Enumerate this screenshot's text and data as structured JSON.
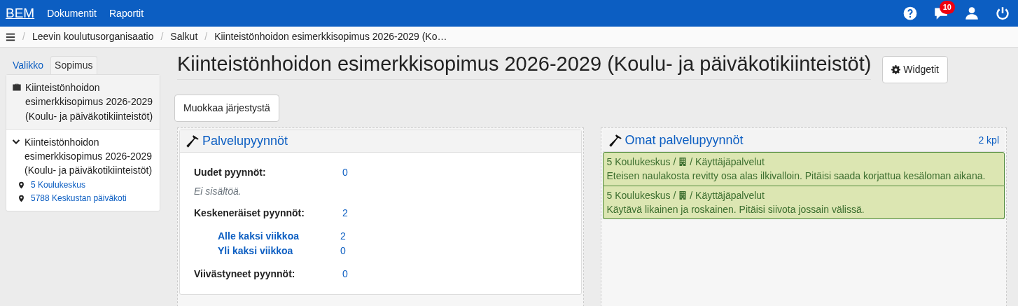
{
  "navbar": {
    "brand": "BEM",
    "links": [
      "Dokumentit",
      "Raportit"
    ],
    "notification_count": "10"
  },
  "breadcrumb": {
    "separator": "/",
    "items": [
      "Leevin koulutusorganisaatio",
      "Salkut",
      "Kiinteistönhoidon esimerkkisopimus 2026-2029 (Ko…"
    ]
  },
  "sidebar": {
    "tabs": [
      {
        "label": "Valikko",
        "selected": false
      },
      {
        "label": "Sopimus",
        "selected": true
      }
    ],
    "contract_title": "Kiinteistönhoidon esimerkkisopimus 2026-2029 (Koulu- ja päiväkotikiinteistöt)",
    "tree": {
      "label": "Kiinteistönhoidon esimerkkisopimus 2026-2029 (Koulu- ja päiväkotikiinteistöt)",
      "expanded": true,
      "children": [
        {
          "label": "5 Koulukeskus"
        },
        {
          "label": "5788 Keskustan päiväkoti"
        }
      ]
    }
  },
  "page": {
    "title": "Kiinteistönhoidon esimerkkisopimus 2026-2029 (Koulu- ja päiväkotikiinteistöt)",
    "widgets_button": "Widgetit",
    "reorder_button": "Muokkaa järjestystä"
  },
  "widgets": [
    {
      "kind": "summary",
      "title": "Palvelupyynnöt",
      "rows": [
        {
          "kind": "heading",
          "label": "Uudet pyynnöt:",
          "value": "0"
        },
        {
          "kind": "empty",
          "label": "Ei sisältöä."
        },
        {
          "kind": "heading",
          "label": "Keskeneräiset pyynnöt:",
          "value": "2"
        },
        {
          "kind": "sub",
          "label": "Alle kaksi viikkoa",
          "value": "2"
        },
        {
          "kind": "sub",
          "label": "Yli kaksi viikkoa",
          "value": "0"
        },
        {
          "kind": "heading",
          "label": "Viivästyneet pyynnöt:",
          "value": "0"
        }
      ]
    },
    {
      "kind": "list",
      "title": "Omat palvelupyynnöt",
      "count": "2 kpl",
      "items": [
        {
          "location": "5 Koulukeskus /",
          "category": "/ Käyttäjäpalvelut",
          "description": "Eteisen naulakosta revitty osa alas ilkivalloin. Pitäisi saada korjattua kesäloman aikana."
        },
        {
          "location": "5 Koulukeskus /",
          "category": "/ Käyttäjäpalvelut",
          "description": "Käytävä likainen ja roskainen. Pitäisi siivota jossain välissä."
        }
      ]
    }
  ]
}
